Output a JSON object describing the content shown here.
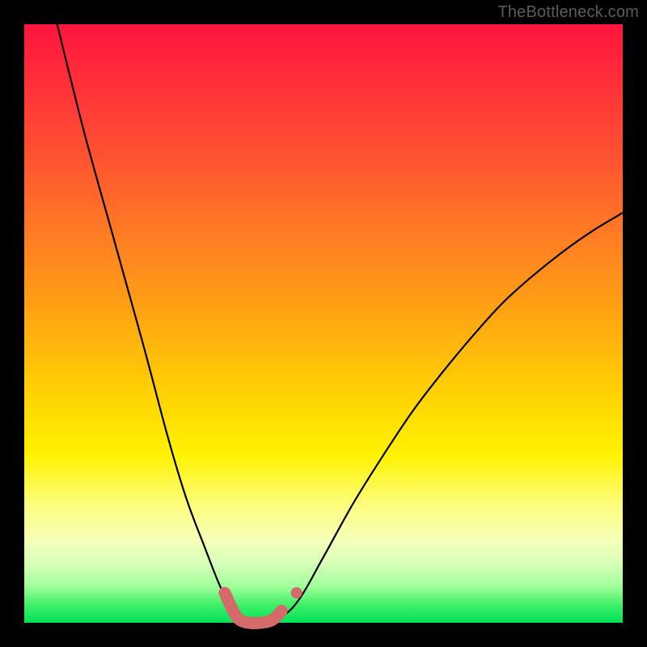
{
  "watermark": "TheBottleneck.com",
  "chart_data": {
    "type": "line",
    "title": "",
    "xlabel": "",
    "ylabel": "",
    "xlim": [
      0,
      1
    ],
    "ylim": [
      0,
      1
    ],
    "series": [
      {
        "name": "curve",
        "x": [
          0.055,
          0.1,
          0.15,
          0.2,
          0.24,
          0.27,
          0.3,
          0.33,
          0.355,
          0.375,
          0.4,
          0.43,
          0.46,
          0.5,
          0.55,
          0.6,
          0.65,
          0.7,
          0.75,
          0.8,
          0.85,
          0.9,
          0.95,
          1.0
        ],
        "y": [
          1.0,
          0.82,
          0.64,
          0.46,
          0.31,
          0.21,
          0.13,
          0.055,
          0.015,
          0.0,
          0.0,
          0.01,
          0.04,
          0.11,
          0.2,
          0.28,
          0.355,
          0.42,
          0.48,
          0.535,
          0.58,
          0.62,
          0.655,
          0.685
        ]
      }
    ],
    "highlight": {
      "name": "bottom-marker",
      "color": "#d46a6a",
      "points_x": [
        0.335,
        0.35,
        0.36,
        0.375,
        0.395,
        0.415,
        0.43
      ],
      "points_y": [
        0.05,
        0.018,
        0.005,
        0.0,
        0.0,
        0.005,
        0.02
      ],
      "extra_dot": {
        "x": 0.455,
        "y": 0.05
      }
    }
  }
}
